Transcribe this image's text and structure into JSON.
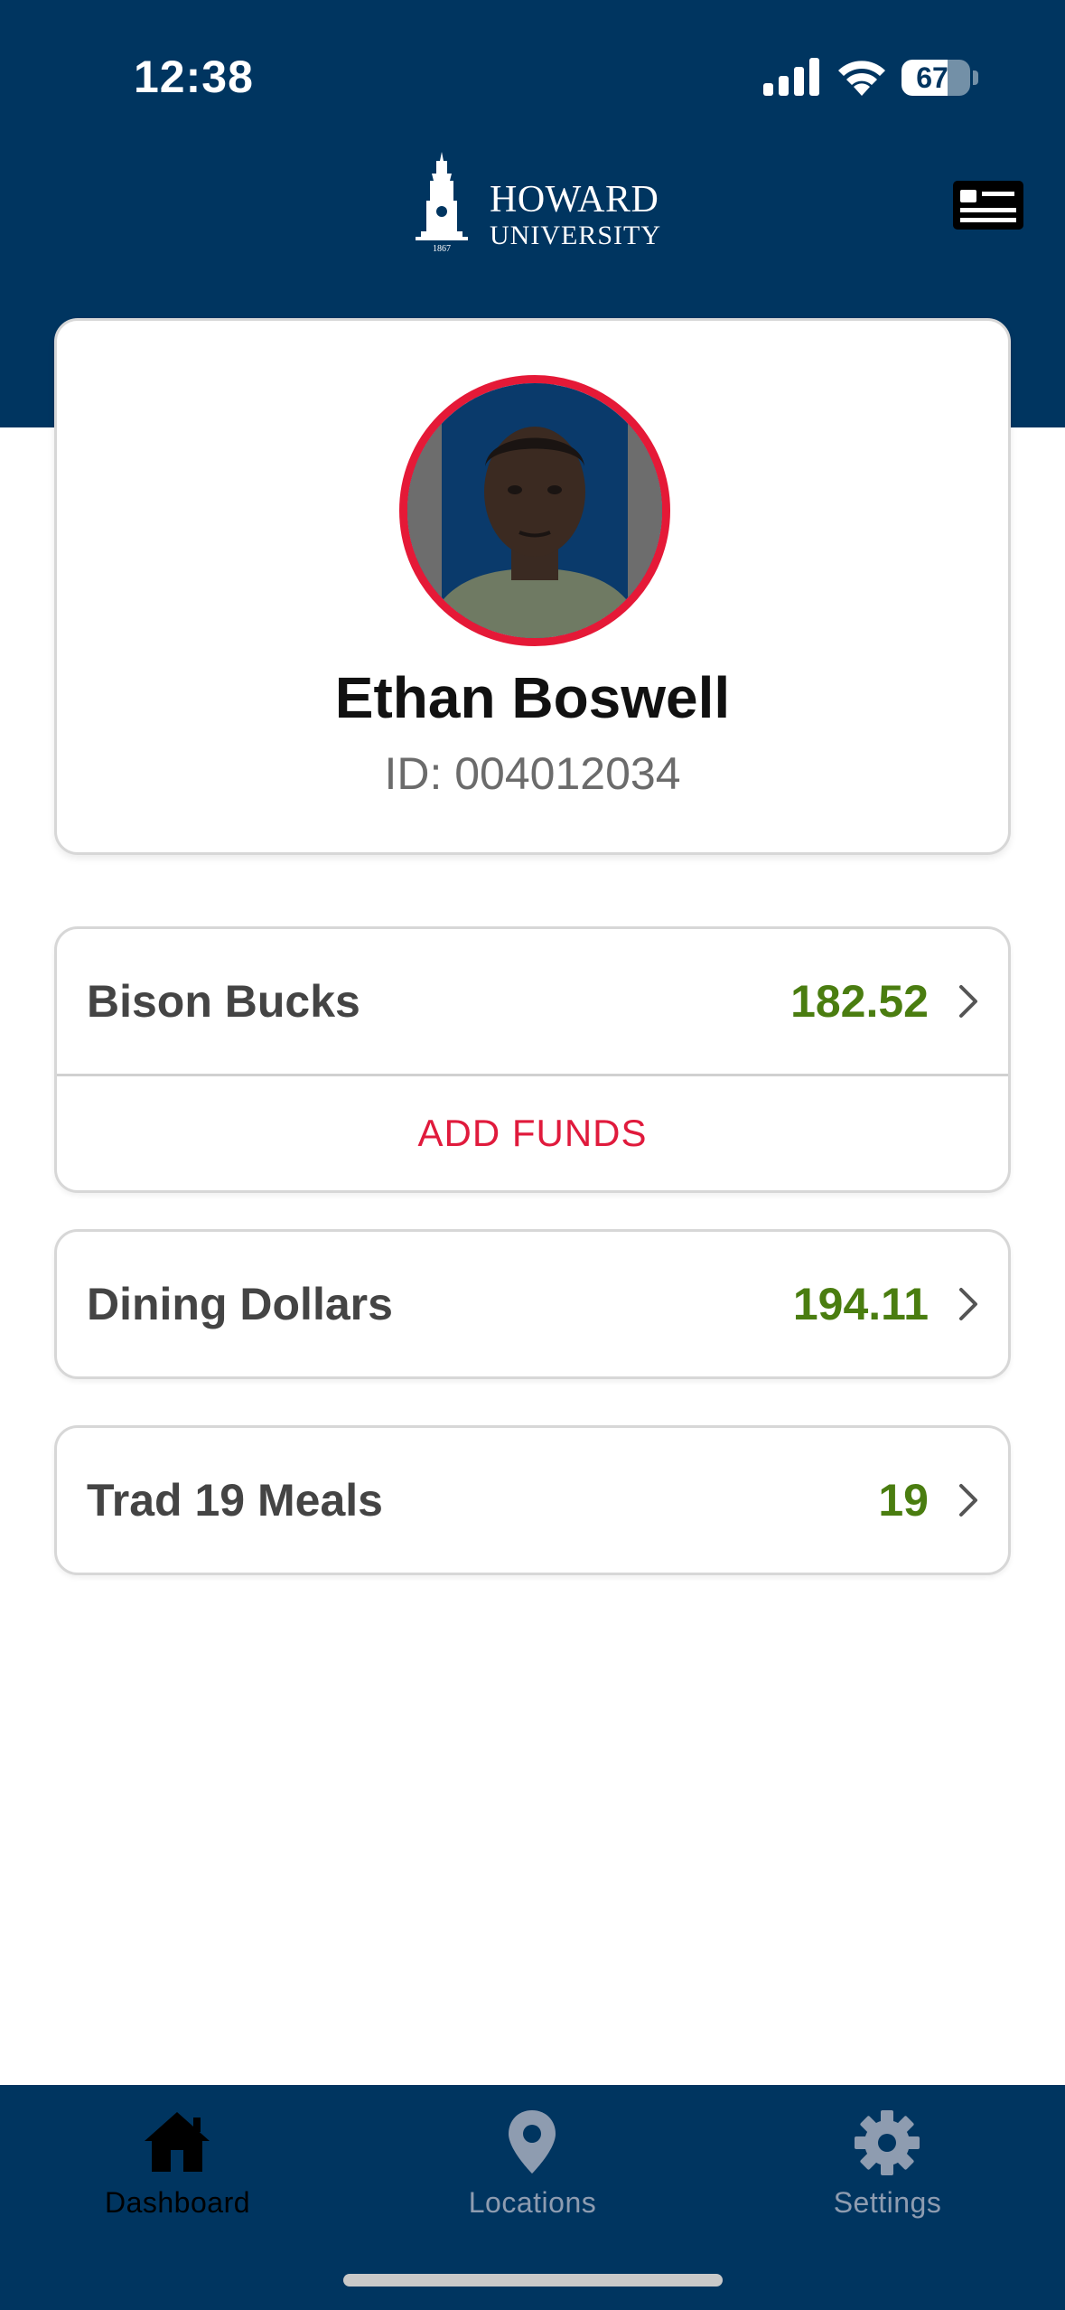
{
  "status_bar": {
    "time": "12:38",
    "battery_level": "67",
    "battery_fraction": 0.67
  },
  "header": {
    "logo_line1": "HOWARD",
    "logo_line2": "UNIVERSITY",
    "logo_year": "1867"
  },
  "profile": {
    "name": "Ethan Boswell",
    "id": "ID: 004012034"
  },
  "balances": {
    "bison_bucks": {
      "label": "Bison Bucks",
      "value": "182.52",
      "action": "ADD FUNDS"
    },
    "dining_dollars": {
      "label": "Dining Dollars",
      "value": "194.11"
    },
    "meals": {
      "label": "Trad 19 Meals",
      "value": "19"
    }
  },
  "tabs": [
    {
      "label": "Dashboard",
      "icon": "home-icon",
      "active": true
    },
    {
      "label": "Locations",
      "icon": "map-pin-icon",
      "active": false
    },
    {
      "label": "Settings",
      "icon": "gear-icon",
      "active": false
    }
  ],
  "colors": {
    "brand_navy": "#003560",
    "accent_red": "#e51937",
    "value_green": "#4a7d10"
  }
}
